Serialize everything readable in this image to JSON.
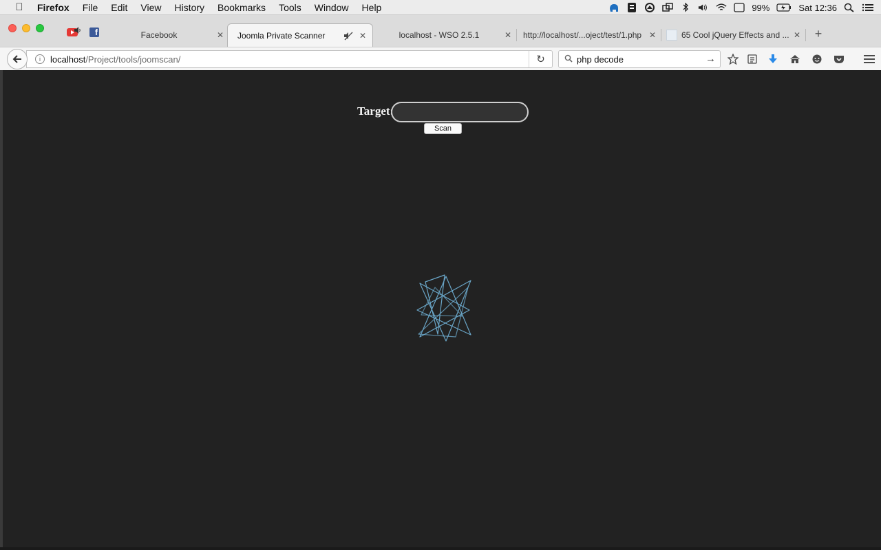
{
  "menubar": {
    "app_name": "Firefox",
    "items": [
      "File",
      "Edit",
      "View",
      "History",
      "Bookmarks",
      "Tools",
      "Window",
      "Help"
    ],
    "battery": "99%",
    "clock": "Sat 12:36"
  },
  "tabs": [
    {
      "label": "Facebook",
      "active": false
    },
    {
      "label": "Joomla Private Scanner",
      "active": true
    },
    {
      "label": "localhost - WSO 2.5.1",
      "active": false
    },
    {
      "label": "http://localhost/...oject/test/1.php",
      "active": false
    },
    {
      "label": "65 Cool jQuery Effects and ...",
      "active": false
    }
  ],
  "urlbar": {
    "host": "localhost",
    "path": "/Project/tools/joomscan/"
  },
  "search": {
    "value": "php decode"
  },
  "page": {
    "target_label": "Target:",
    "target_value": "",
    "scan_label": "Scan"
  },
  "icons": {
    "apple": "apple-icon",
    "back": "back-arrow-icon",
    "reload": "reload-icon",
    "bookmark": "star-icon",
    "reader": "reading-list-icon",
    "download": "download-icon",
    "home": "home-icon",
    "menu": "hamburger-icon",
    "loader": "spinning-star-loader"
  },
  "colors": {
    "page_background": "#222222",
    "loader_stroke": "#6aa6c8"
  }
}
